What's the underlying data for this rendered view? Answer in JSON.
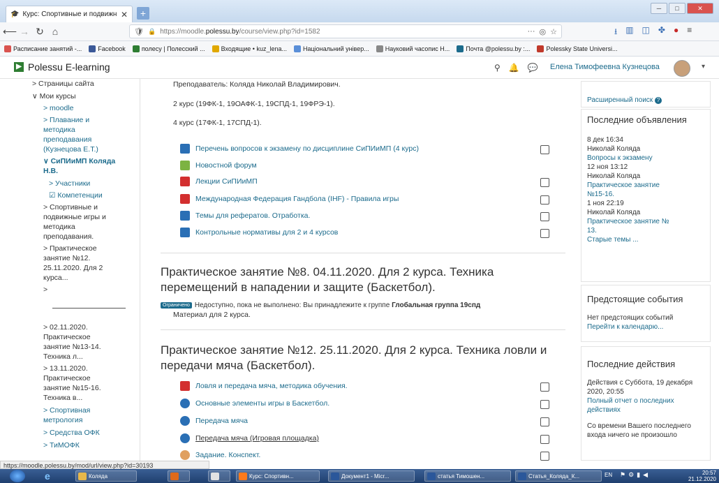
{
  "browser": {
    "tab_title": "Курс: Спортивные и подвижн...",
    "url_plain": "https://moodle.",
    "url_host": "polessu.by",
    "url_rest": "/course/view.php?id=1582",
    "url_more": "···",
    "status_url": "https://moodle.polessu.by/mod/url/view.php?id=30193"
  },
  "bookmarks": [
    {
      "label": "Расписание занятий -...",
      "color": "#d9534f"
    },
    {
      "label": "Facebook",
      "color": "#3b5998"
    },
    {
      "label": "полесу | Полесский ...",
      "color": "#2e7d32"
    },
    {
      "label": "Входящие • kuz_lena...",
      "color": "#e0a800"
    },
    {
      "label": "Національний універ...",
      "color": "#5a8fd8"
    },
    {
      "label": "Науковий часопис Н...",
      "color": "#888888"
    },
    {
      "label": "Почта @polessu.by :...",
      "color": "#1c6b8c"
    },
    {
      "label": "Polessky State Universi...",
      "color": "#c0392b"
    }
  ],
  "header": {
    "brand": "Polessu E-learning",
    "user": "Елена Тимофеевна Кузнецова"
  },
  "leftnav": {
    "items": [
      "> Страницы сайта",
      "∨ Мои курсы",
      "> moodle",
      "> Плавание и",
      "методика",
      "преподавания",
      "(Кузнецова Е.Т.)",
      "∨ СиПИиМП Коляда",
      "Н.В.",
      "> Участники",
      "☑ Компетенции",
      "> Спортивные и",
      "подвижные игры и",
      "методика",
      "преподавания.",
      "> Практическое",
      "занятие №12.",
      "25.11.2020. Для 2",
      "курса...",
      ">",
      "> 02.11.2020.",
      "Практическое",
      "занятие №13-14.",
      "Техника л...",
      "> 13.11.2020.",
      "Практическое",
      "занятие №15-16.",
      "Техника в...",
      "> Спортивная",
      "метрология",
      "> Средства ОФК",
      "> ТиМОФК"
    ]
  },
  "main": {
    "teachers": "Преподаватель: Коляда Николай Владимирович.",
    "course2": "2 курс (19ФК-1, 19ОАФК-1, 19СПД-1, 19ФРЭ-1).",
    "course4": "4 курс (17ФК-1, 17СПД-1).",
    "activities": [
      {
        "label": "Перечень вопросов к экзамену по дисциплине СиПИиМП (4 курс)",
        "icon": "file-icon",
        "color": "#2a6fb5",
        "check": true
      },
      {
        "label": "Новостной форум",
        "icon": "forum-icon",
        "color": "#7cb342",
        "check": false
      },
      {
        "label": "Лекции СиПИиМП",
        "icon": "pdf-icon",
        "color": "#d32f2f",
        "check": true
      },
      {
        "label": "Международная Федерация Гандбола (IHF) - Правила игры",
        "icon": "pdf-icon",
        "color": "#d32f2f",
        "check": true
      },
      {
        "label": "Темы для рефератов. Отработка.",
        "icon": "file-icon",
        "color": "#2a6fb5",
        "check": true
      },
      {
        "label": "Контрольные нормативы для 2 и 4 курсов",
        "icon": "file-icon",
        "color": "#2a6fb5",
        "check": true
      }
    ],
    "section8_title": "Практическое занятие №8. 04.11.2020. Для 2 курса. Техника перемещений в нападении и защите (Баскетбол).",
    "restricted_badge": "Ограничено",
    "restricted_text": "Недоступно, пока не выполнено: Вы принадлежите к группе",
    "restricted_group": "Глобальная группа 19спд",
    "material": "Материал для 2 курса.",
    "section12_title": "Практическое занятие №12. 25.11.2020. Для 2 курса. Техника ловли и передачи мяча (Баскетбол).",
    "activities12": [
      {
        "label": "Ловля и передача мяча, методика обучения.",
        "icon": "pdf-icon",
        "color": "#d32f2f"
      },
      {
        "label": "Основные элементы игры в Баскетбол.",
        "icon": "url-icon",
        "color": "#2a6fb5"
      },
      {
        "label": "Передача мяча",
        "icon": "url-icon",
        "color": "#2a6fb5"
      },
      {
        "label": "Передача мяча (Игровая площадка)",
        "icon": "url-icon",
        "color": "#2a6fb5"
      },
      {
        "label": "Задание. Конспект.",
        "icon": "assign-icon",
        "color": "#e0a060"
      }
    ]
  },
  "blocks": {
    "search": {
      "link": "Расширенный поиск"
    },
    "news": {
      "title": "Последние объявления",
      "lines": [
        "8 дек 16:34",
        "Николай Коляда",
        "Вопросы к экзамену",
        "12 ноя 13:12",
        "Николай Коляда",
        "Практическое занятие",
        "№15-16.",
        "1 ноя 22:19",
        "Николай Коляда",
        "Практическое занятие №",
        "13.",
        "Старые темы ..."
      ]
    },
    "events": {
      "title": "Предстоящие события",
      "none": "Нет предстоящих событий",
      "link": "Перейти к календарю..."
    },
    "recent": {
      "title": "Последние действия",
      "since": "Действия с Суббота, 19 декабря 2020, 20:55",
      "report": "Полный отчет о последних действиях",
      "nothing": "Со времени Вашего последнего входа ничего не произошло"
    }
  },
  "taskbar": {
    "items": [
      "Коляда",
      "",
      "",
      "Курс: Спортивн...",
      "Документ1 - Micr...",
      "статья Тимошен...",
      "Статья_Коляда_К..."
    ],
    "lang": "EN",
    "time": "20:57",
    "date": "21.12.2020"
  }
}
